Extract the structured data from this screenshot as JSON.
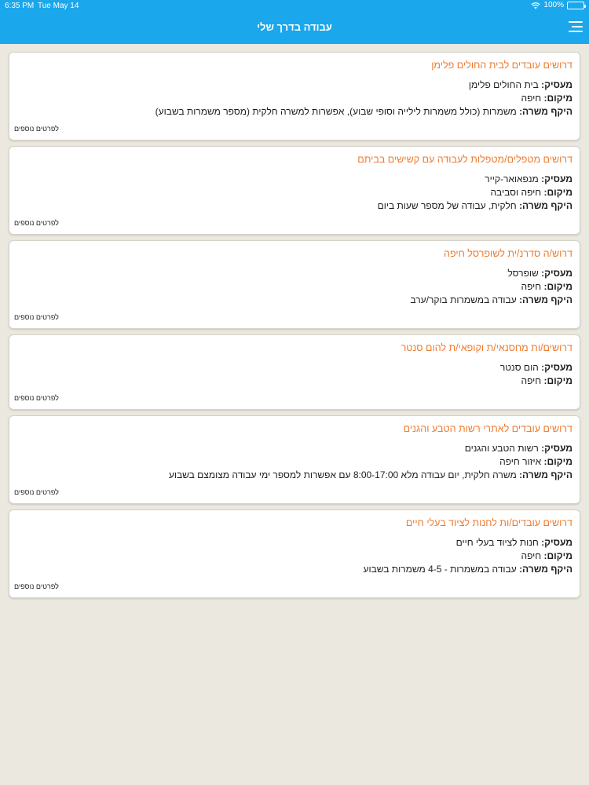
{
  "status": {
    "time": "6:35 PM",
    "date": "Tue May 14",
    "battery": "100%"
  },
  "header": {
    "title": "עבודה בדרך שלי",
    "menu_icon": "hamburger-menu-icon"
  },
  "labels": {
    "employer": "מעסיק:",
    "location": "מיקום:",
    "scope": "היקף משרה:",
    "more": "לפרטים נוספים"
  },
  "jobs": [
    {
      "title": "דרושים עובדים לבית החולים פלימן",
      "employer": "בית החולים פלימן",
      "location": "חיפה",
      "scope": "משמרות (כולל משמרות לילייה וסופי שבוע), אפשרות למשרה חלקית (מספר משמרות בשבוע)"
    },
    {
      "title": "דרושים מטפלים/מטפלות לעבודה עם קשישים בביתם",
      "employer": "מנפאואר-קייר",
      "location": "חיפה וסביבה",
      "scope": "חלקית, עבודה של מספר שעות ביום"
    },
    {
      "title": "דרוש/ה סדרנ/ית לשופרסל חיפה",
      "employer": "שופרסל",
      "location": "חיפה",
      "scope": "עבודה במשמרות בוקר/ערב"
    },
    {
      "title": "דרושים/ות מחסנאי/ת וקופאי/ת להום סנטר",
      "employer": "הום סנטר",
      "location": "חיפה",
      "scope": ""
    },
    {
      "title": "דרושים עובדים לאתרי רשות הטבע והגנים",
      "employer": "רשות הטבע והגנים",
      "location": "איזור חיפה",
      "scope": "משרה חלקית, יום עבודה מלא 8:00-17:00 עם אפשרות למספר ימי עבודה מצומצם בשבוע"
    },
    {
      "title": "דרושים עובדים/ות לחנות לציוד בעלי חיים",
      "employer": "חנות לציוד בעלי חיים",
      "location": "חיפה",
      "scope": "עבודה במשמרות - 4-5 משמרות בשבוע"
    }
  ]
}
